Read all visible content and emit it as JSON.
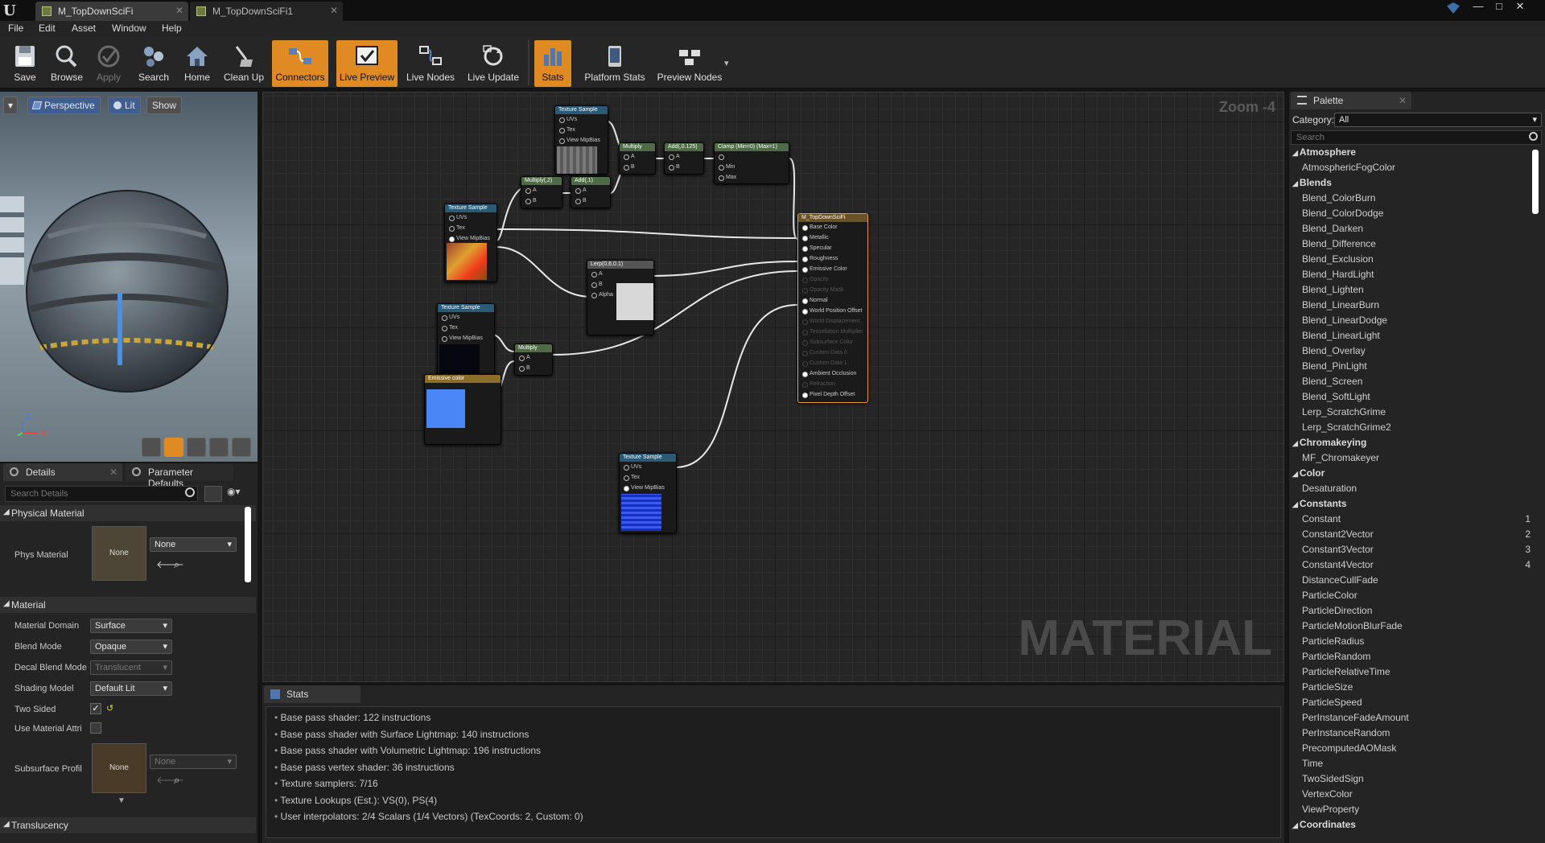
{
  "window": {
    "tabs": [
      {
        "label": "M_TopDownSciFi",
        "active": true
      },
      {
        "label": "M_TopDownSciFi1",
        "active": false
      }
    ],
    "controls": [
      "—",
      "□",
      "✕"
    ]
  },
  "menu": [
    "File",
    "Edit",
    "Asset",
    "Window",
    "Help"
  ],
  "toolbar": [
    {
      "label": "Save",
      "icon": "save-icon",
      "state": "normal"
    },
    {
      "label": "Browse",
      "icon": "browse-icon",
      "state": "normal"
    },
    {
      "label": "Apply",
      "icon": "apply-icon",
      "state": "disabled"
    },
    {
      "label": "Search",
      "icon": "search-icon",
      "state": "normal"
    },
    {
      "label": "Home",
      "icon": "home-icon",
      "state": "normal"
    },
    {
      "label": "Clean Up",
      "icon": "cleanup-icon",
      "state": "normal"
    },
    {
      "label": "Connectors",
      "icon": "connectors-icon",
      "state": "active"
    },
    {
      "label": "Live Preview",
      "icon": "live-preview-icon",
      "state": "active"
    },
    {
      "label": "Live Nodes",
      "icon": "live-nodes-icon",
      "state": "normal"
    },
    {
      "label": "Live Update",
      "icon": "live-update-icon",
      "state": "normal"
    },
    {
      "label": "Stats",
      "icon": "stats-icon",
      "state": "active"
    },
    {
      "label": "Platform Stats",
      "icon": "platform-stats-icon",
      "state": "normal"
    },
    {
      "label": "Preview Nodes",
      "icon": "preview-nodes-icon",
      "state": "normal"
    }
  ],
  "viewport": {
    "perspective": "Perspective",
    "lit": "Lit",
    "show": "Show",
    "axis_z": "Z",
    "axis_x": "X"
  },
  "details": {
    "tab_details": "Details",
    "tab_params": "Parameter Defaults",
    "search_placeholder": "Search Details",
    "physical_section": "Physical Material",
    "phys_material_label": "Phys Material",
    "phys_material_thumb": "None",
    "phys_material_value": "None",
    "material_section": "Material",
    "props": [
      {
        "label": "Material Domain",
        "value": "Surface",
        "enabled": true
      },
      {
        "label": "Blend Mode",
        "value": "Opaque",
        "enabled": true
      },
      {
        "label": "Decal Blend Mode",
        "value": "Translucent",
        "enabled": false
      },
      {
        "label": "Shading Model",
        "value": "Default Lit",
        "enabled": true
      }
    ],
    "two_sided_label": "Two Sided",
    "two_sided": true,
    "use_material_attr_label": "Use Material Attri",
    "use_material_attr": false,
    "subsurface_label": "Subsurface Profil",
    "subsurface_thumb": "None",
    "subsurface_value": "None",
    "translucency_section": "Translucency"
  },
  "graph": {
    "zoom": "Zoom -4",
    "watermark": "MATERIAL",
    "nodes": {
      "tex1": {
        "title": "Texture Sample",
        "pins": [
          "UVs",
          "Tex",
          "View MipBias"
        ]
      },
      "tex2": {
        "title": "Texture Sample",
        "pins": [
          "UVs",
          "Tex",
          "View MipBias"
        ]
      },
      "tex3": {
        "title": "Texture Sample",
        "pins": [
          "UVs",
          "Tex",
          "View MipBias"
        ]
      },
      "tex4": {
        "title": "Texture Sample",
        "pins": [
          "UVs",
          "Tex",
          "View MipBias"
        ]
      },
      "multiply1": {
        "title": "Multiply",
        "pins": [
          "A",
          "B"
        ]
      },
      "add1": {
        "title": "Add(,0.125)",
        "pins": [
          "A",
          "B"
        ]
      },
      "clamp": {
        "title": "Clamp (Min=0) (Max=1)",
        "pins": [
          "",
          "Min",
          "Max"
        ]
      },
      "multiply2": {
        "title": "Multiply(,2)",
        "pins": [
          "A",
          "B"
        ]
      },
      "add2": {
        "title": "Add(,1)",
        "pins": [
          "A",
          "B"
        ]
      },
      "lerp": {
        "title": "Lerp(0,6,0.1)",
        "pins": [
          "A",
          "B",
          "Alpha"
        ]
      },
      "multiply3": {
        "title": "Multiply",
        "pins": [
          "A",
          "B"
        ]
      },
      "emissive": {
        "title": "Emissive color"
      },
      "output": {
        "title": "M_TopDownSciFi",
        "pins": [
          {
            "label": "Base Color",
            "active": true
          },
          {
            "label": "Metallic",
            "active": true
          },
          {
            "label": "Specular",
            "active": true
          },
          {
            "label": "Roughness",
            "active": true
          },
          {
            "label": "Emissive Color",
            "active": true
          },
          {
            "label": "Opacity",
            "active": false
          },
          {
            "label": "Opacity Mask",
            "active": false
          },
          {
            "label": "Normal",
            "active": true
          },
          {
            "label": "World Position Offset",
            "active": true
          },
          {
            "label": "World Displacement",
            "active": false
          },
          {
            "label": "Tessellation Multiplier",
            "active": false
          },
          {
            "label": "Subsurface Color",
            "active": false
          },
          {
            "label": "Custom Data 0",
            "active": false
          },
          {
            "label": "Custom Data 1",
            "active": false
          },
          {
            "label": "Ambient Occlusion",
            "active": true
          },
          {
            "label": "Refraction",
            "active": false
          },
          {
            "label": "Pixel Depth Offset",
            "active": true
          }
        ]
      }
    }
  },
  "stats": {
    "tab": "Stats",
    "lines": [
      "Base pass shader: 122 instructions",
      "Base pass shader with Surface Lightmap: 140 instructions",
      "Base pass shader with Volumetric Lightmap: 196 instructions",
      "Base pass vertex shader: 36 instructions",
      "Texture samplers: 7/16",
      "Texture Lookups (Est.): VS(0), PS(4)",
      "User interpolators: 2/4 Scalars (1/4 Vectors) (TexCoords: 2, Custom: 0)"
    ]
  },
  "palette": {
    "tab": "Palette",
    "category_label": "Category:",
    "category_value": "All",
    "search_placeholder": "Search",
    "entries": [
      {
        "type": "cat",
        "label": "Atmosphere"
      },
      {
        "type": "item",
        "label": "AtmosphericFogColor"
      },
      {
        "type": "cat",
        "label": "Blends"
      },
      {
        "type": "item",
        "label": "Blend_ColorBurn"
      },
      {
        "type": "item",
        "label": "Blend_ColorDodge"
      },
      {
        "type": "item",
        "label": "Blend_Darken"
      },
      {
        "type": "item",
        "label": "Blend_Difference"
      },
      {
        "type": "item",
        "label": "Blend_Exclusion"
      },
      {
        "type": "item",
        "label": "Blend_HardLight"
      },
      {
        "type": "item",
        "label": "Blend_Lighten"
      },
      {
        "type": "item",
        "label": "Blend_LinearBurn"
      },
      {
        "type": "item",
        "label": "Blend_LinearDodge"
      },
      {
        "type": "item",
        "label": "Blend_LinearLight"
      },
      {
        "type": "item",
        "label": "Blend_Overlay"
      },
      {
        "type": "item",
        "label": "Blend_PinLight"
      },
      {
        "type": "item",
        "label": "Blend_Screen"
      },
      {
        "type": "item",
        "label": "Blend_SoftLight"
      },
      {
        "type": "item",
        "label": "Lerp_ScratchGrime"
      },
      {
        "type": "item",
        "label": "Lerp_ScratchGrime2"
      },
      {
        "type": "cat",
        "label": "Chromakeying"
      },
      {
        "type": "item",
        "label": "MF_Chromakeyer"
      },
      {
        "type": "cat",
        "label": "Color"
      },
      {
        "type": "item",
        "label": "Desaturation"
      },
      {
        "type": "cat",
        "label": "Constants"
      },
      {
        "type": "item",
        "label": "Constant",
        "key": "1"
      },
      {
        "type": "item",
        "label": "Constant2Vector",
        "key": "2"
      },
      {
        "type": "item",
        "label": "Constant3Vector",
        "key": "3"
      },
      {
        "type": "item",
        "label": "Constant4Vector",
        "key": "4"
      },
      {
        "type": "item",
        "label": "DistanceCullFade"
      },
      {
        "type": "item",
        "label": "ParticleColor"
      },
      {
        "type": "item",
        "label": "ParticleDirection"
      },
      {
        "type": "item",
        "label": "ParticleMotionBlurFade"
      },
      {
        "type": "item",
        "label": "ParticleRadius"
      },
      {
        "type": "item",
        "label": "ParticleRandom"
      },
      {
        "type": "item",
        "label": "ParticleRelativeTime"
      },
      {
        "type": "item",
        "label": "ParticleSize"
      },
      {
        "type": "item",
        "label": "ParticleSpeed"
      },
      {
        "type": "item",
        "label": "PerInstanceFadeAmount"
      },
      {
        "type": "item",
        "label": "PerInstanceRandom"
      },
      {
        "type": "item",
        "label": "PrecomputedAOMask"
      },
      {
        "type": "item",
        "label": "Time"
      },
      {
        "type": "item",
        "label": "TwoSidedSign"
      },
      {
        "type": "item",
        "label": "VertexColor"
      },
      {
        "type": "item",
        "label": "ViewProperty"
      },
      {
        "type": "cat",
        "label": "Coordinates"
      }
    ]
  },
  "colors": {
    "accent": "#e08a24",
    "highlight_blue": "#3f5f93",
    "emissive_swatch": "#4a86f5"
  }
}
